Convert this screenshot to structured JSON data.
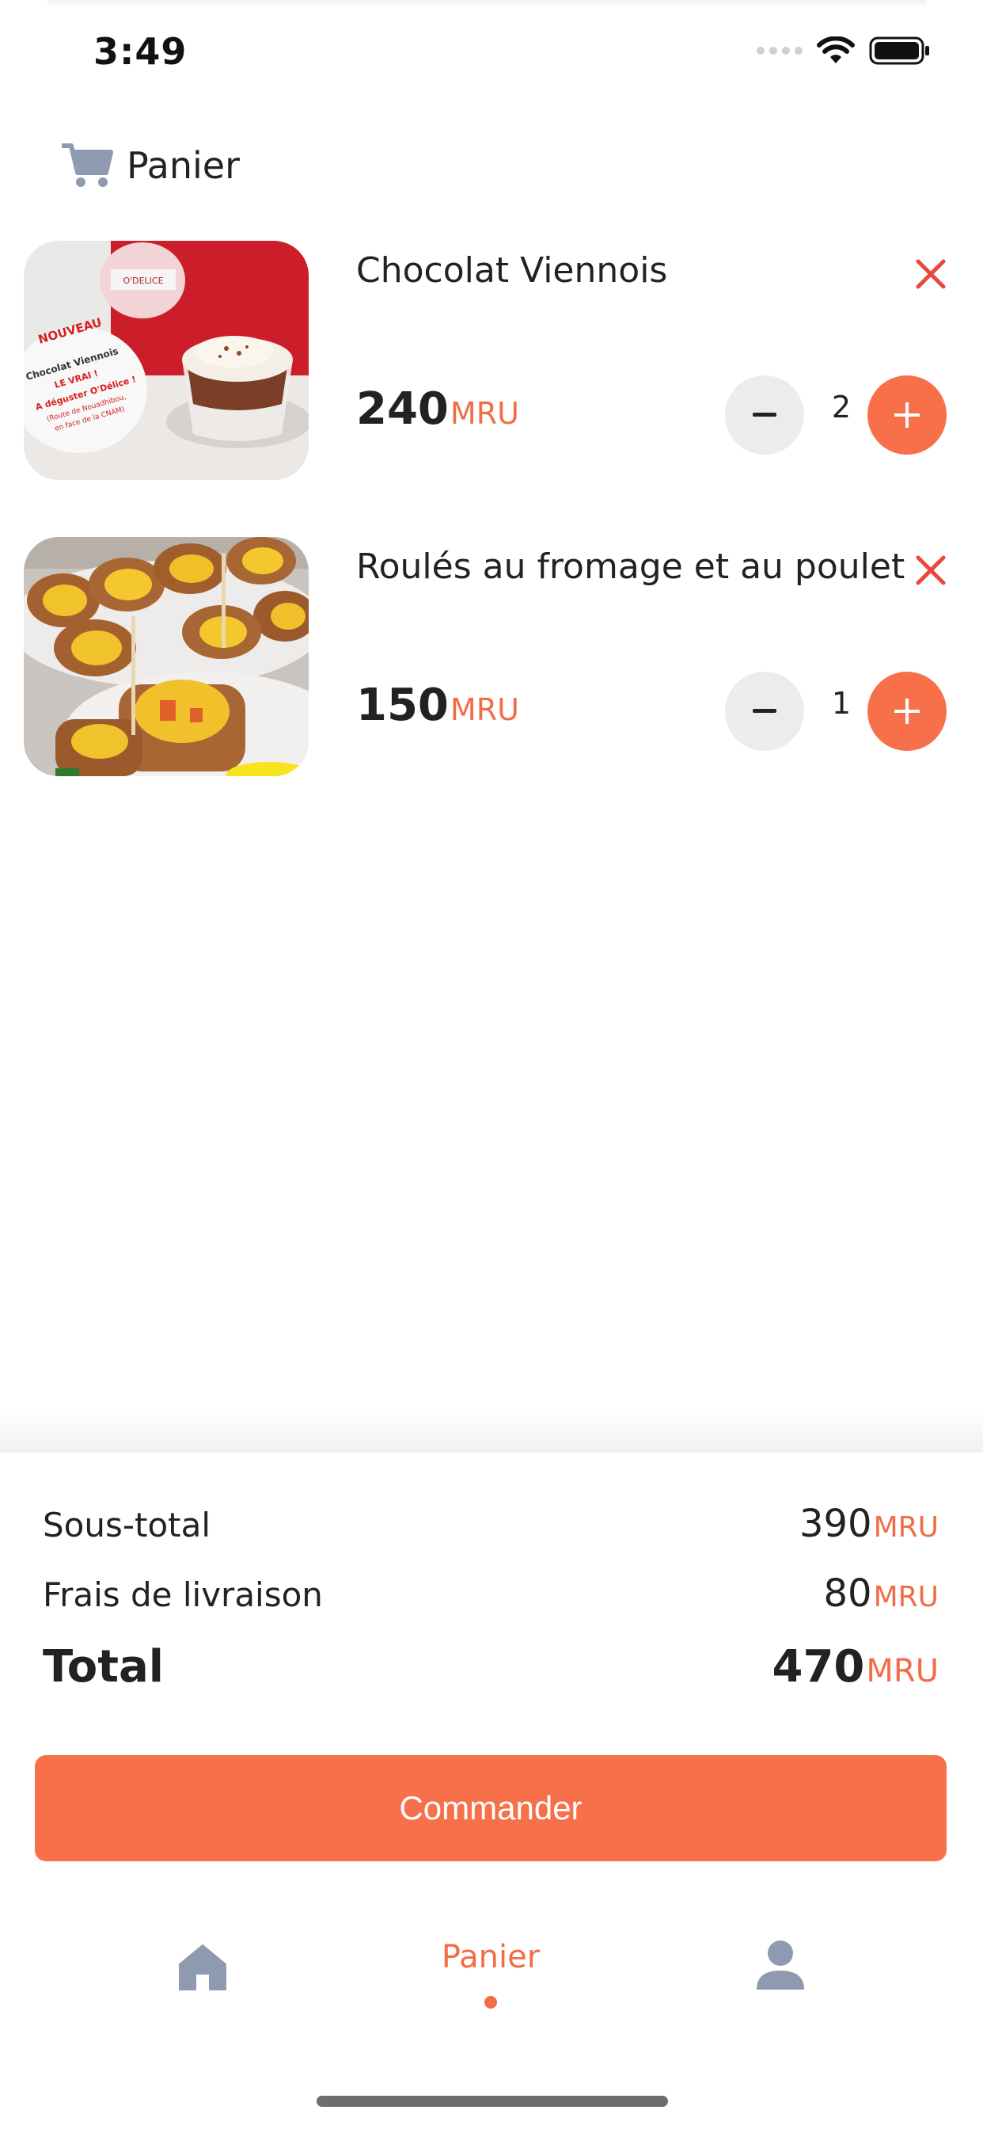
{
  "status_bar": {
    "time": "3:49",
    "icons": [
      "signal-dots-icon",
      "wifi-icon",
      "battery-icon"
    ]
  },
  "header": {
    "icon": "cart-icon",
    "title": "Panier"
  },
  "items": [
    {
      "name": "Chocolat Viennois",
      "price": "240",
      "currency": "MRU",
      "quantity": "2",
      "image_text": {
        "headline": "NOUVEAU",
        "line1": "Chocolat Viennois",
        "line2": "LE VRAI !",
        "line3": "A déguster O'Délice !",
        "line4": "(Route de Nouadhibou,",
        "line5": "en face de la CNAM)",
        "sign": "O'DELICE"
      }
    },
    {
      "name": "Roulés au fromage et au poulet",
      "price": "150",
      "currency": "MRU",
      "quantity": "1"
    }
  ],
  "summary": {
    "subtotal_label": "Sous-total",
    "subtotal_value": "390",
    "delivery_label": "Frais de livraison",
    "delivery_value": "80",
    "total_label": "Total",
    "total_value": "470",
    "currency": "MRU"
  },
  "order_button": {
    "label": "Commander"
  },
  "tabbar": {
    "tabs": [
      {
        "icon": "home-icon",
        "label": ""
      },
      {
        "icon": "",
        "label": "Panier",
        "active": true
      },
      {
        "icon": "profile-icon",
        "label": ""
      }
    ]
  },
  "colors": {
    "accent": "#f8704a",
    "currency": "#f26d47",
    "remove": "#e8483e",
    "icon_gray": "#8e9aaf"
  }
}
